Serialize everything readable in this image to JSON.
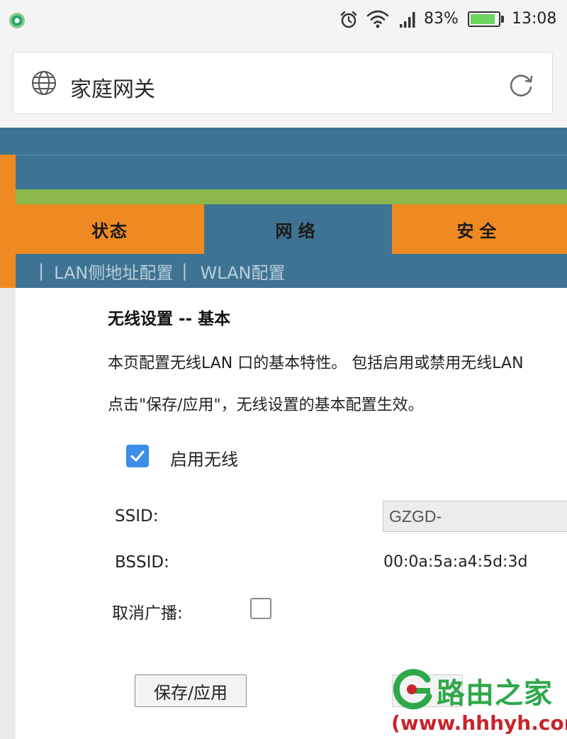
{
  "status_bar": {
    "battery": "83%",
    "time": "13:08",
    "icons": [
      "app-icon",
      "alarm-icon",
      "wifi-icon",
      "signal-icon",
      "battery-icon"
    ]
  },
  "browser": {
    "page_title": "家庭网关",
    "icons": [
      "globe-icon",
      "reload-icon"
    ]
  },
  "router": {
    "tabs": [
      "状态",
      "网络",
      "安全"
    ],
    "subnav": {
      "separator": "|",
      "items": [
        "LAN侧地址配置",
        "WLAN配置"
      ]
    },
    "colors": {
      "header_blue": "#3f7393",
      "tab_orange": "#ef8a22",
      "accent_green": "#8cb84b"
    }
  },
  "wireless": {
    "title": "无线设置 -- 基本",
    "desc_line1": "本页配置无线LAN 口的基本特性。 包括启用或禁用无线LAN",
    "desc_line2": "点击\"保存/应用\"，无线设置的基本配置生效。",
    "enable_label": "启用无线",
    "enable_checked": true,
    "ssid_label": "SSID:",
    "ssid_value": "GZGD-",
    "bssid_label": "BSSID:",
    "bssid_value": "00:0a:5a:a4:5d:3d",
    "hide_broadcast_label": "取消广播:",
    "hide_broadcast_checked": false,
    "save_label": "保存/应用"
  },
  "watermark": {
    "name": "路由之家",
    "url": "(www.hhhyh.com)"
  }
}
